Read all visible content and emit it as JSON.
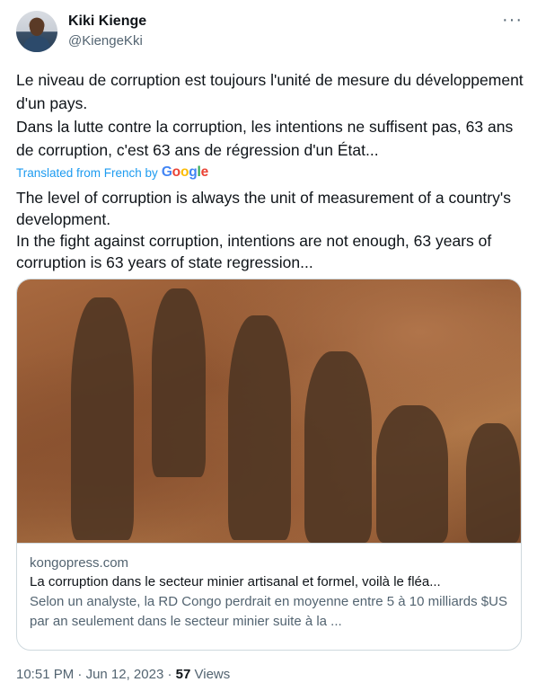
{
  "author": {
    "name": "Kiki Kienge",
    "handle": "@KiengeKki"
  },
  "more_icon": "more-horizontal-icon",
  "original_text": [
    "Le niveau de corruption est toujours l'unité de mesure du développement d'un pays.",
    "Dans la lutte contre la corruption, les intentions ne suffisent pas, 63 ans de corruption, c'est 63 ans de régression d'un État..."
  ],
  "translation_label": "Translated from French by",
  "translation_provider": [
    "G",
    "o",
    "o",
    "g",
    "l",
    "e"
  ],
  "translated_text": [
    "The level of corruption is always the unit of measurement of a country's development.",
    "In the fight against corruption, intentions are not enough, 63 years of corruption is 63 years of state regression..."
  ],
  "link_card": {
    "domain": "kongopress.com",
    "title": "La corruption dans le secteur minier artisanal et formel, voilà le fléa...",
    "description": "Selon un analyste, la RD Congo perdrait en moyenne entre 5 à 10 milliards $US par an seulement dans le secteur minier suite à la ..."
  },
  "meta": {
    "time": "10:51 PM",
    "separator": "·",
    "date": "Jun 12, 2023",
    "views_count": "57",
    "views_label": "Views"
  },
  "colors": {
    "accent": "#1d9bf0",
    "text": "#0f1419",
    "muted": "#536471",
    "border": "#cfd9de"
  }
}
